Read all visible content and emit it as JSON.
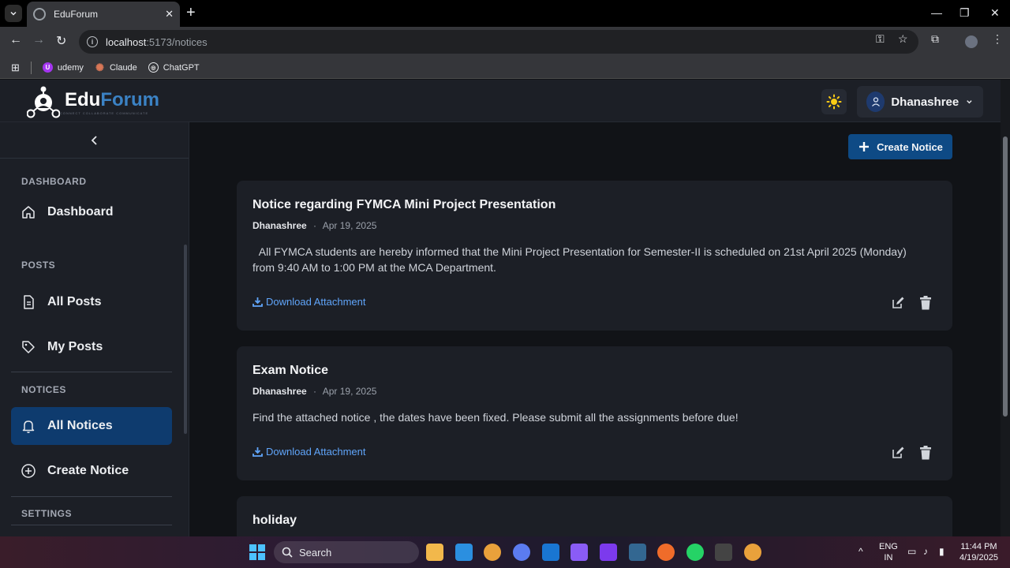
{
  "browser": {
    "tab_title": "EduForum",
    "url_host": "localhost",
    "url_path": ":5173/notices",
    "bookmarks": [
      "udemy",
      "Claude",
      "ChatGPT"
    ]
  },
  "header": {
    "logo_edu": "Edu",
    "logo_forum": "Forum",
    "logo_tagline": "CONNECT COLLABORATE COMMUNICATE",
    "user_name": "Dhanashree"
  },
  "sidebar": {
    "sections": {
      "dashboard": "DASHBOARD",
      "posts": "POSTS",
      "notices": "NOTICES",
      "settings": "SETTINGS"
    },
    "items": {
      "dashboard": "Dashboard",
      "all_posts": "All Posts",
      "my_posts": "My Posts",
      "all_notices": "All Notices",
      "create_notice": "Create Notice"
    }
  },
  "main": {
    "create_button": "Create Notice",
    "notices": [
      {
        "title": "Notice regarding FYMCA Mini Project Presentation",
        "author": "Dhanashree",
        "date": "Apr 19, 2025",
        "body": "  All FYMCA students are hereby informed that the Mini Project Presentation for Semester-II is scheduled on 21st April 2025 (Monday) from 9:40 AM to 1:00 PM at the MCA Department.",
        "attachment": "Download Attachment"
      },
      {
        "title": "Exam Notice",
        "author": "Dhanashree",
        "date": "Apr 19, 2025",
        "body": "Find the attached notice , the dates have been fixed. Please submit all the assignments before due!",
        "attachment": "Download Attachment"
      },
      {
        "title": "holiday"
      }
    ],
    "meta_separator": "·"
  },
  "taskbar": {
    "search": "Search",
    "lang_top": "ENG",
    "lang_bottom": "IN",
    "time": "11:44 PM",
    "date": "4/19/2025"
  },
  "colors": {
    "accent": "#0e3b6e",
    "button": "#0e4a85",
    "link": "#60a5fa",
    "brand_forum": "#3b82c4"
  }
}
